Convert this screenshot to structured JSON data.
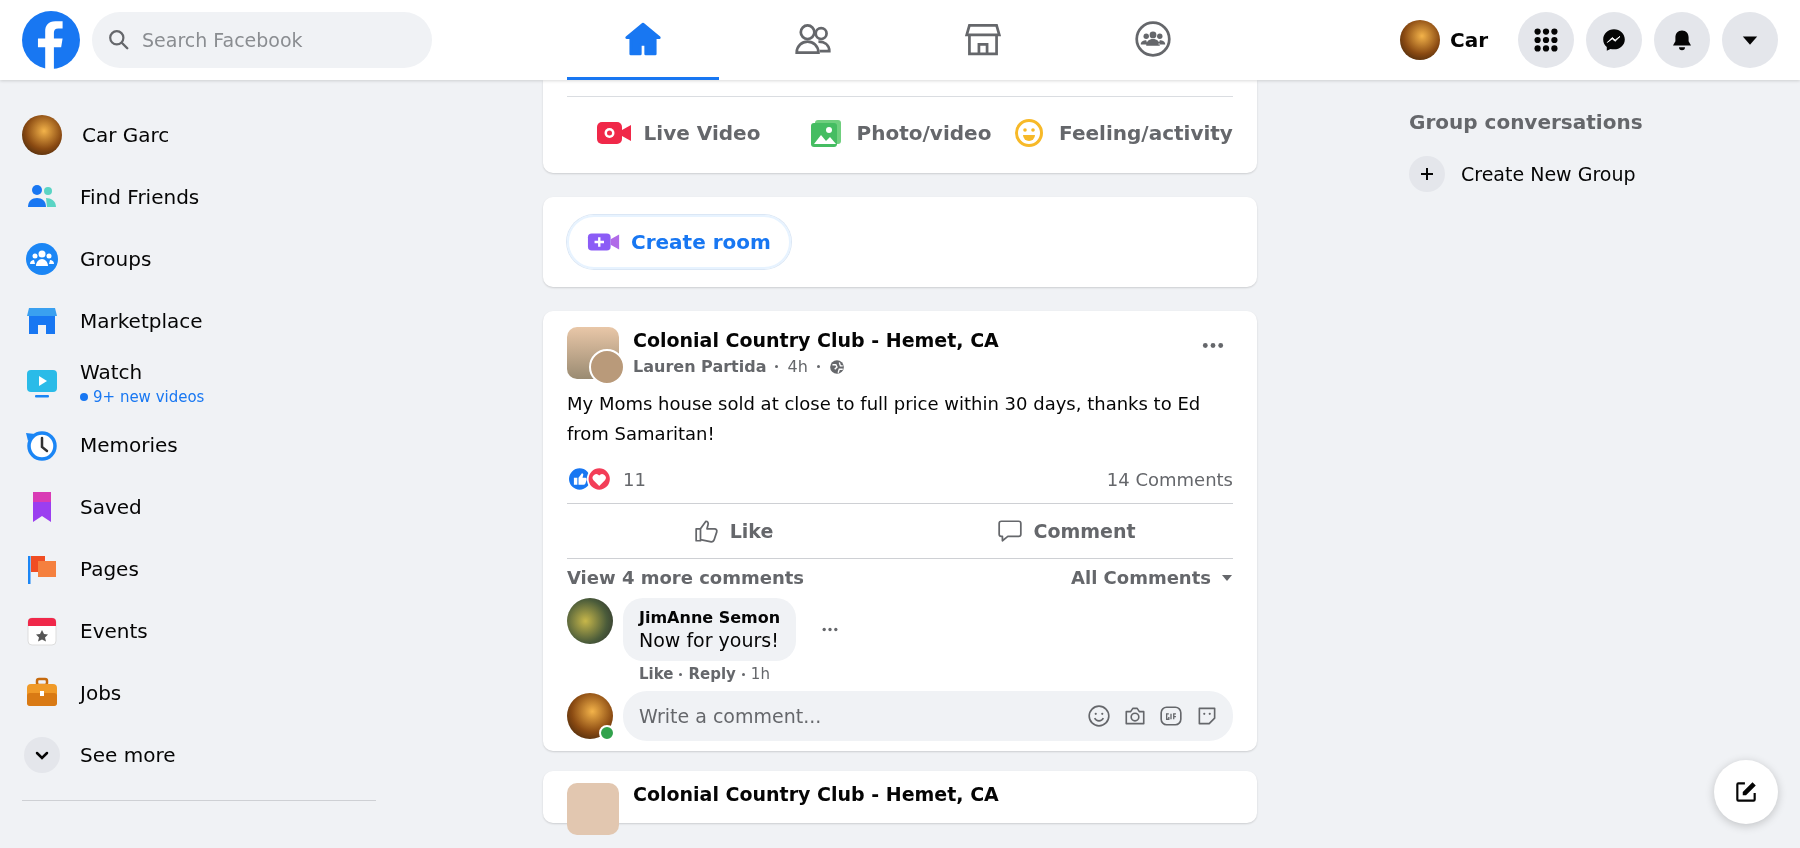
{
  "header": {
    "search": {
      "placeholder": "Search Facebook"
    },
    "nav_tabs": [
      {
        "selected": true
      },
      {
        "selected": false
      },
      {
        "selected": false
      },
      {
        "selected": false
      }
    ],
    "profile_name": "Car"
  },
  "sidebar": {
    "items": [
      {
        "label": "Car Garc",
        "kind": "profile"
      },
      {
        "label": "Find Friends",
        "kind": "link"
      },
      {
        "label": "Groups",
        "kind": "link"
      },
      {
        "label": "Marketplace",
        "kind": "link"
      },
      {
        "label": "Watch",
        "kind": "link",
        "subtitle": "9+ new videos"
      },
      {
        "label": "Memories",
        "kind": "link"
      },
      {
        "label": "Saved",
        "kind": "link"
      },
      {
        "label": "Pages",
        "kind": "link"
      },
      {
        "label": "Events",
        "kind": "link"
      },
      {
        "label": "Jobs",
        "kind": "link"
      }
    ],
    "see_more": "See more"
  },
  "feed": {
    "composer_actions": [
      "Live Video",
      "Photo/video",
      "Feeling/activity"
    ],
    "create_room": "Create room",
    "post": {
      "group": "Colonial Country Club - Hemet, CA",
      "author": "Lauren Partida",
      "time": "4h",
      "text": "My Moms house sold at close to full price within 30 days, thanks to Ed from Samaritan!",
      "reactions_count": "11",
      "comments_count": "14 Comments",
      "actions": [
        "Like",
        "Comment"
      ],
      "view_more": "View 4 more comments",
      "filter": "All Comments",
      "comments": [
        {
          "author": "JimAnne Semon",
          "text": "Now for yours!",
          "actions": [
            "Like",
            "Reply"
          ],
          "time": "1h"
        }
      ],
      "comment_placeholder": "Write a comment..."
    },
    "next_post": {
      "group": "Colonial Country Club - Hemet, CA"
    }
  },
  "right": {
    "heading": "Group conversations",
    "create_group": "Create New Group"
  }
}
